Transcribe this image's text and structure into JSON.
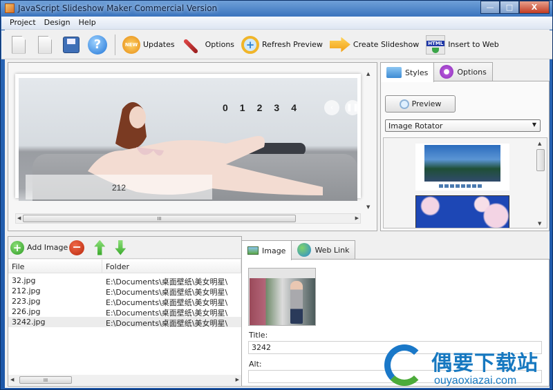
{
  "window": {
    "title": "JavaScript Slideshow Maker Commercial Version",
    "minimize": "—",
    "maximize": "□",
    "close": "X"
  },
  "menu": [
    "Project",
    "Design",
    "Help"
  ],
  "toolbar": {
    "updates": "Updates",
    "options": "Options",
    "refresh_preview": "Refresh Preview",
    "create_slideshow": "Create Slideshow",
    "insert_to_web": "Insert to Web",
    "new_badge": "NEW",
    "help_glyph": "?"
  },
  "preview": {
    "caption": "212",
    "nav_numbers": [
      "0",
      "1",
      "2",
      "3",
      "4"
    ],
    "prev_glyph": "‹",
    "pause_glyph": "❚❚",
    "scroll_grip": "III"
  },
  "right_panel": {
    "tabs": [
      "Styles",
      "Options"
    ],
    "preview_button": "Preview",
    "style_select": "Image Rotator"
  },
  "image_list": {
    "add_image": "Add Image",
    "columns": [
      "File",
      "Folder"
    ],
    "rows": [
      {
        "file": "32.jpg",
        "folder": "E:\\Documents\\桌面壁纸\\美女明星\\"
      },
      {
        "file": "212.jpg",
        "folder": "E:\\Documents\\桌面壁纸\\美女明星\\"
      },
      {
        "file": "223.jpg",
        "folder": "E:\\Documents\\桌面壁纸\\美女明星\\"
      },
      {
        "file": "226.jpg",
        "folder": "E:\\Documents\\桌面壁纸\\美女明星\\"
      },
      {
        "file": "3242.jpg",
        "folder": "E:\\Documents\\桌面壁纸\\美女明星\\"
      }
    ],
    "selected_index": 4,
    "scroll_grip": "III"
  },
  "detail": {
    "tabs": [
      "Image",
      "Web Link"
    ],
    "title_label": "Title:",
    "title_value": "3242",
    "alt_label": "Alt:",
    "alt_value": ""
  },
  "watermark": {
    "text": "偶要下载站",
    "url": "ouyaoxiazai.com"
  }
}
